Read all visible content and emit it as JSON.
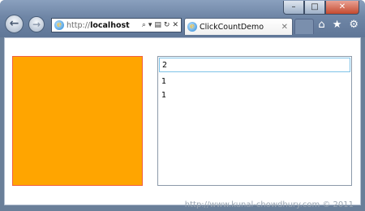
{
  "browser": {
    "address": {
      "prefix": "http://",
      "host": "localhost"
    },
    "tab": {
      "title": "ClickCountDemo"
    },
    "window_controls": {
      "minimize": "–",
      "maximize": "□",
      "close": "✕"
    }
  },
  "app": {
    "input_value": "2",
    "list_items": [
      "1",
      "1"
    ]
  },
  "watermark": "http://www.kunal-chowdhury.com © 2011",
  "colors": {
    "box": "#ffa500",
    "box_border": "#f06040"
  }
}
